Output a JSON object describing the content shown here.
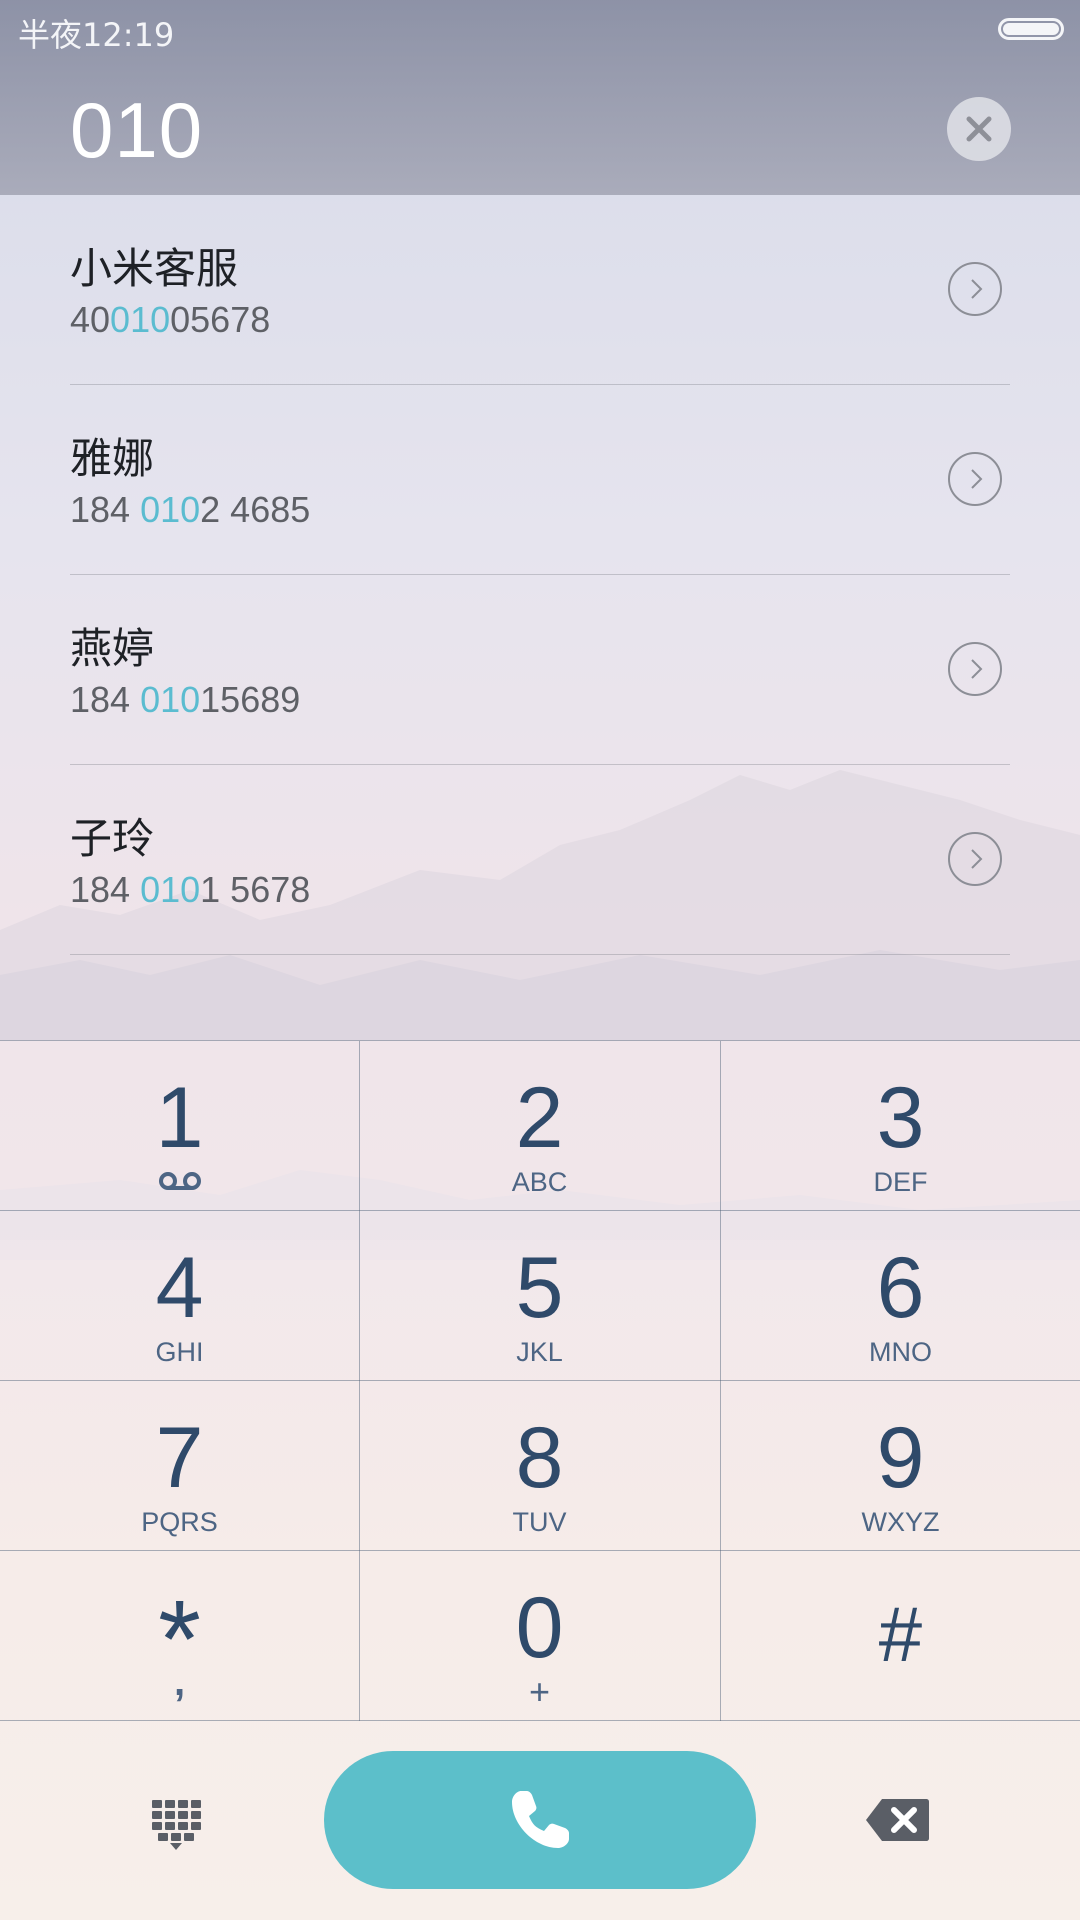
{
  "status_bar": {
    "time": "半夜12:19"
  },
  "dialer": {
    "input_value": "010"
  },
  "results": [
    {
      "name": "小米客服",
      "number_parts": [
        "40",
        "010",
        "05678"
      ]
    },
    {
      "name": "雅娜",
      "number_parts": [
        "184 ",
        "010",
        "2 4685"
      ]
    },
    {
      "name": "燕婷",
      "number_parts": [
        "184 ",
        "010",
        "15689"
      ]
    },
    {
      "name": "子玲",
      "number_parts": [
        "184 ",
        "010",
        "1 5678"
      ]
    }
  ],
  "keypad": {
    "keys": [
      {
        "digit": "1",
        "letters": ""
      },
      {
        "digit": "2",
        "letters": "ABC"
      },
      {
        "digit": "3",
        "letters": "DEF"
      },
      {
        "digit": "4",
        "letters": "GHI"
      },
      {
        "digit": "5",
        "letters": "JKL"
      },
      {
        "digit": "6",
        "letters": "MNO"
      },
      {
        "digit": "7",
        "letters": "PQRS"
      },
      {
        "digit": "8",
        "letters": "TUV"
      },
      {
        "digit": "9",
        "letters": "WXYZ"
      },
      {
        "digit": "*",
        "letters": ","
      },
      {
        "digit": "0",
        "letters": "+"
      },
      {
        "digit": "#",
        "letters": ""
      }
    ]
  },
  "icons": {
    "voicemail": "voicemail-icon",
    "clear": "close-icon",
    "detail": "chevron-right-icon",
    "keypad_toggle": "dialpad-icon",
    "call": "phone-icon",
    "backspace": "backspace-icon"
  },
  "colors": {
    "accent": "#5cbfca",
    "highlight": "#5bbcd0",
    "key_text": "#2f4a6a"
  }
}
